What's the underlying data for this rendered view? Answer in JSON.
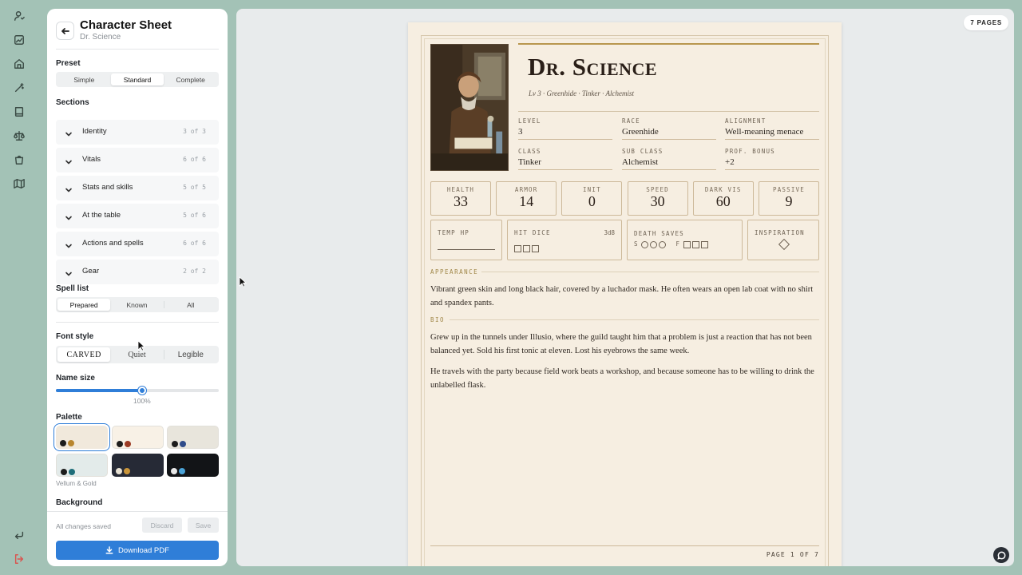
{
  "rail": {
    "icons": [
      "user-icon",
      "chart-icon",
      "home-icon",
      "wand-icon",
      "book-icon",
      "scales-icon",
      "bag-icon",
      "map-icon",
      "return-icon",
      "logout-icon"
    ]
  },
  "panel": {
    "title": "Character Sheet",
    "subtitle": "Dr. Science",
    "preset": {
      "label": "Preset",
      "options": [
        "Simple",
        "Standard",
        "Complete"
      ],
      "selected": "Standard"
    },
    "sections": {
      "label": "Sections",
      "items": [
        {
          "name": "Identity",
          "count": "3 of 3"
        },
        {
          "name": "Vitals",
          "count": "6 of 6"
        },
        {
          "name": "Stats and skills",
          "count": "5 of 5"
        },
        {
          "name": "At the table",
          "count": "5 of 6"
        },
        {
          "name": "Actions and spells",
          "count": "6 of 6"
        },
        {
          "name": "Gear",
          "count": "2 of 2"
        }
      ]
    },
    "spell_list": {
      "label": "Spell list",
      "options": [
        "Prepared",
        "Known",
        "All"
      ],
      "selected": "Prepared"
    },
    "font_style": {
      "label": "Font style",
      "options": [
        "CARVED",
        "Quiet",
        "Legible"
      ],
      "selected": "CARVED"
    },
    "name_size": {
      "label": "Name size",
      "value_text": "100%",
      "fraction": 0.53
    },
    "palette": {
      "label": "Palette",
      "selected_name": "Vellum & Gold",
      "swatches": [
        {
          "bg": "#f1e9dc",
          "dots": [
            "#1d1d1d",
            "#b8862f"
          ],
          "selected": true
        },
        {
          "bg": "#f8f1e6",
          "dots": [
            "#1d1d1d",
            "#9b3b25"
          ],
          "selected": false
        },
        {
          "bg": "#e8e5dc",
          "dots": [
            "#1d1d1d",
            "#2f4c8a"
          ],
          "selected": false
        },
        {
          "bg": "#e3ebea",
          "dots": [
            "#1d1d1d",
            "#1f6e7a"
          ],
          "selected": false
        },
        {
          "bg": "#262a36",
          "dots": [
            "#e8e2d4",
            "#c9953a"
          ],
          "selected": false
        },
        {
          "bg": "#121417",
          "dots": [
            "#e8e8e8",
            "#4aa3d8"
          ],
          "selected": false
        }
      ]
    },
    "background_label": "Background",
    "footer": {
      "status": "All changes saved",
      "discard": "Discard",
      "save": "Save",
      "download": "Download PDF"
    }
  },
  "preview": {
    "pages_badge": "7 PAGES"
  },
  "sheet": {
    "name": "Dr. Science",
    "subtitle": "Lv 3 · Greenhide · Tinker · Alchemist",
    "fields": [
      {
        "label": "LEVEL",
        "value": "3"
      },
      {
        "label": "RACE",
        "value": "Greenhide"
      },
      {
        "label": "ALIGNMENT",
        "value": "Well-meaning menace"
      },
      {
        "label": "CLASS",
        "value": "Tinker"
      },
      {
        "label": "SUB CLASS",
        "value": "Alchemist"
      },
      {
        "label": "PROF. BONUS",
        "value": "+2"
      }
    ],
    "stats": [
      {
        "label": "HEALTH",
        "value": "33"
      },
      {
        "label": "ARMOR",
        "value": "14"
      },
      {
        "label": "INIT",
        "value": "0"
      },
      {
        "label": "SPEED",
        "value": "30"
      },
      {
        "label": "DARK VIS",
        "value": "60"
      },
      {
        "label": "PASSIVE",
        "value": "9"
      }
    ],
    "temp_hp_label": "TEMP HP",
    "hit_dice_label": "HIT DICE",
    "hit_dice_value": "3d8",
    "death_saves_label": "DEATH SAVES",
    "death_s": "S",
    "death_f": "F",
    "inspiration_label": "INSPIRATION",
    "appearance_head": "APPEARANCE",
    "appearance": "Vibrant green skin and long black hair, covered by a luchador mask. He often wears an open lab coat with no shirt and spandex pants.",
    "bio_head": "BIO",
    "bio_1": "Grew up in the tunnels under Illusio, where the guild taught him that a problem is just a reaction that has not been balanced yet. Sold his first tonic at eleven. Lost his eyebrows the same week.",
    "bio_2": "He travels with the party because field work beats a workshop, and because someone has to be willing to drink the unlabelled flask.",
    "page_label": "PAGE 1 OF 7"
  }
}
